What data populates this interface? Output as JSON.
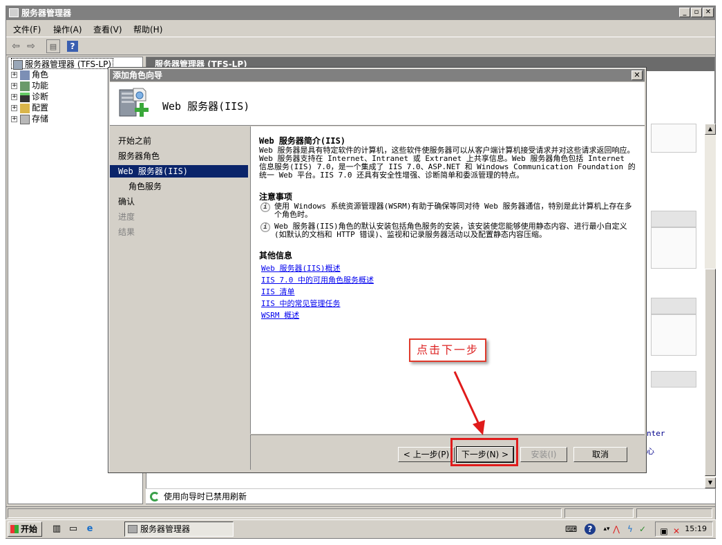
{
  "main_window": {
    "title": "服务器管理器",
    "controls": {
      "minimize": "_",
      "maximize": "▫",
      "close": "✕"
    }
  },
  "menu": {
    "items": [
      "文件(F)",
      "操作(A)",
      "查看(V)",
      "帮助(H)"
    ]
  },
  "toolbar": {
    "back_icon": "back-arrow-icon",
    "forward_icon": "forward-arrow-icon",
    "help_label": "?"
  },
  "tree": {
    "root": "服务器管理器 (TFS-LP)",
    "items": [
      "角色",
      "功能",
      "诊断",
      "配置",
      "存储"
    ]
  },
  "right_pane": {
    "header": "服务器管理器 (TFS-LP)",
    "frag1": "nter",
    "frag2": "心"
  },
  "status_line": "使用向导时已禁用刷新",
  "wizard": {
    "title": "添加角色向导",
    "close_label": "✕",
    "heading": "Web 服务器(IIS)",
    "nav": {
      "items": [
        "开始之前",
        "服务器角色",
        "Web 服务器(IIS)",
        "角色服务",
        "确认",
        "进度",
        "结果"
      ]
    },
    "content": {
      "intro_title": "Web 服务器简介(IIS)",
      "intro_text": "Web 服务器是具有特定软件的计算机，这些软件使服务器可以从客户端计算机接受请求并对这些请求返回响应。Web 服务器支持在 Internet、Intranet 或 Extranet 上共享信息。Web 服务器角色包括 Internet 信息服务(IIS) 7.0，是一个集成了 IIS 7.0、ASP.NET 和 Windows Communication Foundation 的统一 Web 平台。IIS 7.0 还具有安全性增强、诊断简单和委派管理的特点。",
      "notes_title": "注意事项",
      "note1": "使用 Windows 系统资源管理器(WSRM)有助于确保等同对待 Web 服务器通信，特别是此计算机上存在多个角色时。",
      "note2": "Web 服务器(IIS)角色的默认安装包括角色服务的安装，该安装使您能够使用静态内容、进行最小自定义(如默认的文档和 HTTP 错误)、监视和记录服务器活动以及配置静态内容压缩。",
      "more_title": "其他信息",
      "links": [
        "Web 服务器(IIS)概述",
        "IIS 7.0 中的可用角色服务概述",
        "IIS 清单",
        "IIS 中的常见管理任务",
        "WSRM 概述"
      ]
    },
    "buttons": {
      "prev": "< 上一步(P)",
      "next": "下一步(N) >",
      "install": "安装(I)",
      "cancel": "取消"
    }
  },
  "annotation": {
    "callout_text": "点击下一步",
    "color": "#e01b1b"
  },
  "taskbar": {
    "start_label": "开始",
    "task_label": "服务器管理器",
    "time": "15:19"
  }
}
